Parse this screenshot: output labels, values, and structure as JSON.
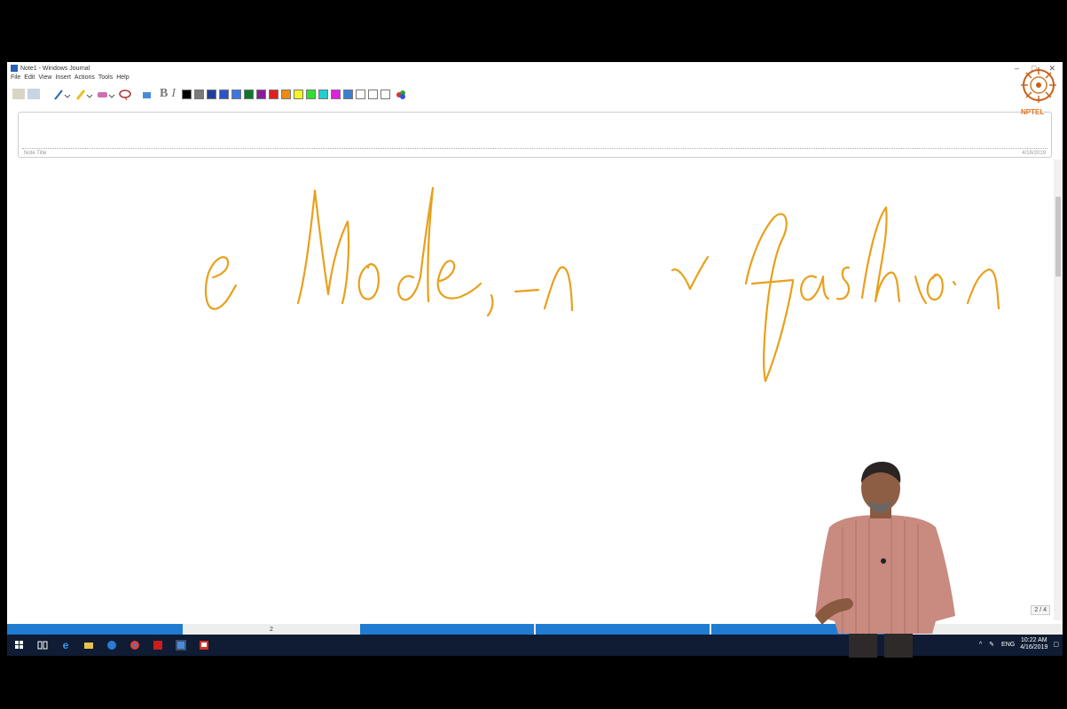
{
  "window": {
    "title": "Note1 - Windows Journal"
  },
  "menu": [
    "File",
    "Edit",
    "View",
    "Insert",
    "Actions",
    "Tools",
    "Help"
  ],
  "toolbar": {
    "bold": "B",
    "italic": "I"
  },
  "note": {
    "title_label": "Note Title",
    "date": "4/16/2019"
  },
  "handwriting": {
    "text": "e Mode,-n ~ fashion",
    "ink_color": "#e8a01c"
  },
  "page": {
    "number": "2",
    "indicator": "2 / 4"
  },
  "watermark": {
    "logo_text": "NPTEL"
  },
  "taskbar": {
    "lang": "ENG",
    "time": "10:22 AM",
    "date": "4/16/2019"
  },
  "palette": [
    "#000000",
    "#7a7a7a",
    "#1f3f9a",
    "#2a55c8",
    "#3a78e6",
    "#0a7a2a",
    "#8a1a9a",
    "#e02020",
    "#f08a10",
    "#f5f520",
    "#30e030",
    "#20d0d0",
    "#e020e0",
    "#3a7fd0",
    "#ffffff",
    "#ffffff",
    "#ffffff"
  ]
}
